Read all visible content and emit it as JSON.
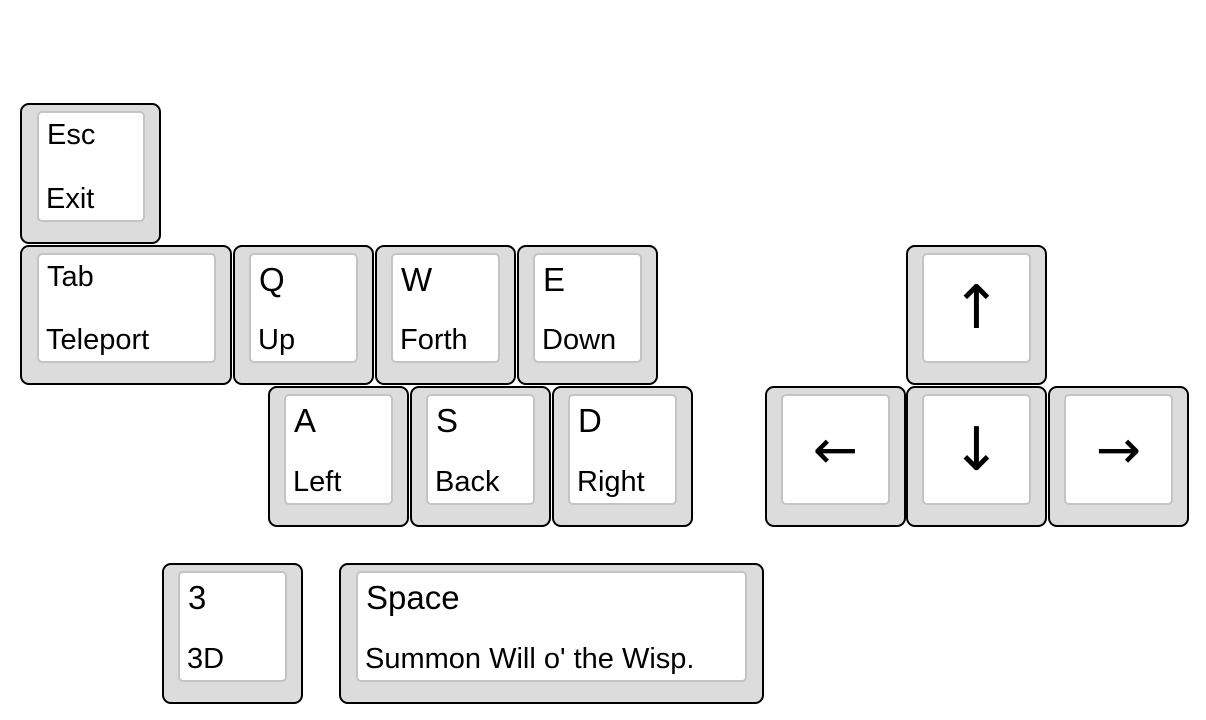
{
  "keys": {
    "esc": {
      "label": "Esc",
      "action": "Exit"
    },
    "tab": {
      "label": "Tab",
      "action": "Teleport"
    },
    "q": {
      "label": "Q",
      "action": "Up"
    },
    "w": {
      "label": "W",
      "action": "Forth"
    },
    "e": {
      "label": "E",
      "action": "Down"
    },
    "a": {
      "label": "A",
      "action": "Left"
    },
    "s": {
      "label": "S",
      "action": "Back"
    },
    "d": {
      "label": "D",
      "action": "Right"
    },
    "three": {
      "label": "3",
      "action": "3D"
    },
    "space": {
      "label": "Space",
      "action": "Summon Will o' the Wisp."
    },
    "arrow_up": {
      "glyph": "↑"
    },
    "arrow_left": {
      "glyph": "←"
    },
    "arrow_down": {
      "glyph": "↓"
    },
    "arrow_right": {
      "glyph": "→"
    }
  },
  "colors": {
    "key_body": "#dcdcdc",
    "key_face": "#ffffff",
    "key_border": "#000000",
    "face_border": "#c4c4c4"
  }
}
